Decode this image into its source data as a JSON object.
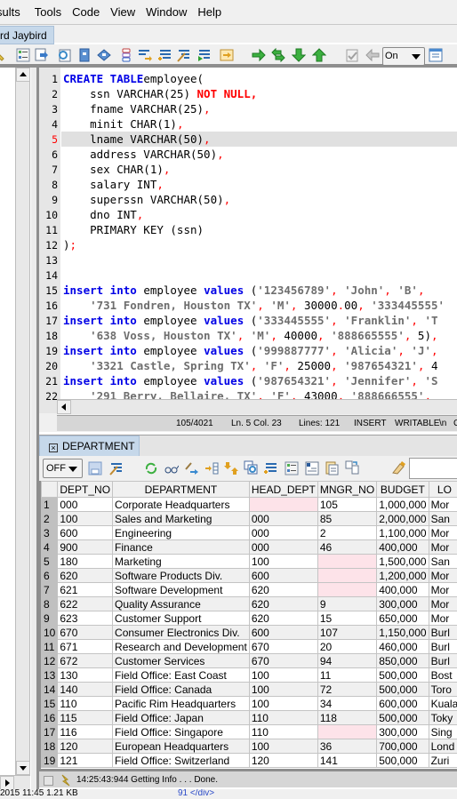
{
  "menubar": {
    "items": [
      "sults",
      "Tools",
      "Code",
      "View",
      "Window",
      "Help"
    ]
  },
  "connection_tab": {
    "label": "rd Jaybird"
  },
  "toolbar": {
    "icons": [
      "plug-icon",
      "form-icon",
      "export-icon",
      "refresh-doc-icon",
      "book-icon",
      "open-book-icon",
      "stack-icon",
      "lines-arrow-icon",
      "lines-plus-icon",
      "lines-pencil-icon",
      "lines-play-icon",
      "table-export-icon",
      "run-arrow-icon",
      "swap-arrows-icon",
      "down-arrow-icon",
      "up-arrow-icon",
      "checklist-icon",
      "back-arrow-icon",
      "panel-icon"
    ],
    "autocommit_select": {
      "value": "On"
    }
  },
  "editor": {
    "lines": [
      {
        "n": "1",
        "tokens": [
          [
            "kw",
            "CREATE TABLE"
          ],
          [
            "",
            "employee("
          ]
        ]
      },
      {
        "n": "2",
        "tokens": [
          [
            "",
            "    ssn VARCHAR(25) "
          ],
          [
            "red",
            "NOT NULL"
          ],
          [
            "red",
            ","
          ]
        ]
      },
      {
        "n": "3",
        "tokens": [
          [
            "",
            "    fname VARCHAR(25)"
          ],
          [
            "pn",
            ","
          ]
        ]
      },
      {
        "n": "4",
        "tokens": [
          [
            "",
            "    minit CHAR(1)"
          ],
          [
            "pn",
            ","
          ]
        ]
      },
      {
        "n": "5",
        "tokens": [
          [
            "",
            "    lname VARCHAR(50)"
          ],
          [
            "pn",
            ","
          ]
        ],
        "current": true
      },
      {
        "n": "6",
        "tokens": [
          [
            "",
            "    address VARCHAR(50)"
          ],
          [
            "pn",
            ","
          ]
        ]
      },
      {
        "n": "7",
        "tokens": [
          [
            "",
            "    sex CHAR(1)"
          ],
          [
            "pn",
            ","
          ]
        ]
      },
      {
        "n": "8",
        "tokens": [
          [
            "",
            "    salary INT"
          ],
          [
            "pn",
            ","
          ]
        ]
      },
      {
        "n": "9",
        "tokens": [
          [
            "",
            "    superssn VARCHAR(50)"
          ],
          [
            "pn",
            ","
          ]
        ]
      },
      {
        "n": "10",
        "tokens": [
          [
            "",
            "    dno INT"
          ],
          [
            "pn",
            ","
          ]
        ]
      },
      {
        "n": "11",
        "tokens": [
          [
            "",
            "    PRIMARY KEY (ssn)"
          ]
        ]
      },
      {
        "n": "12",
        "tokens": [
          [
            "",
            ")"
          ],
          [
            "pn",
            ";"
          ]
        ]
      },
      {
        "n": "13",
        "tokens": []
      },
      {
        "n": "14",
        "tokens": []
      },
      {
        "n": "15",
        "tokens": [
          [
            "kw",
            "insert into"
          ],
          [
            "",
            " employee "
          ],
          [
            "kw",
            "values"
          ],
          [
            "",
            " ("
          ],
          [
            "str",
            "'123456789'"
          ],
          [
            "pn",
            ","
          ],
          [
            "",
            " "
          ],
          [
            "str",
            "'John'"
          ],
          [
            "pn",
            ","
          ],
          [
            "",
            " "
          ],
          [
            "str",
            "'B'"
          ],
          [
            "pn",
            ","
          ]
        ]
      },
      {
        "n": "16",
        "tokens": [
          [
            "",
            "    "
          ],
          [
            "str",
            "'731 Fondren, Houston TX'"
          ],
          [
            "pn",
            ","
          ],
          [
            "",
            " "
          ],
          [
            "str",
            "'M'"
          ],
          [
            "pn",
            ","
          ],
          [
            "",
            " 30000"
          ],
          [
            "pn",
            "."
          ],
          [
            "",
            "00"
          ],
          [
            "pn",
            ","
          ],
          [
            "",
            " "
          ],
          [
            "str",
            "'333445555'"
          ]
        ]
      },
      {
        "n": "17",
        "tokens": [
          [
            "kw",
            "insert into"
          ],
          [
            "",
            " employee "
          ],
          [
            "kw",
            "values"
          ],
          [
            "",
            " ("
          ],
          [
            "str",
            "'333445555'"
          ],
          [
            "pn",
            ","
          ],
          [
            "",
            " "
          ],
          [
            "str",
            "'Franklin'"
          ],
          [
            "pn",
            ","
          ],
          [
            "",
            " "
          ],
          [
            "str",
            "'T"
          ]
        ]
      },
      {
        "n": "18",
        "tokens": [
          [
            "",
            "    "
          ],
          [
            "str",
            "'638 Voss, Houston TX'"
          ],
          [
            "pn",
            ","
          ],
          [
            "",
            " "
          ],
          [
            "str",
            "'M'"
          ],
          [
            "pn",
            ","
          ],
          [
            "",
            " 40000"
          ],
          [
            "pn",
            ","
          ],
          [
            "",
            " "
          ],
          [
            "str",
            "'888665555'"
          ],
          [
            "pn",
            ","
          ],
          [
            "",
            " 5)"
          ],
          [
            "pn",
            ","
          ]
        ]
      },
      {
        "n": "19",
        "tokens": [
          [
            "kw",
            "insert into"
          ],
          [
            "",
            " employee "
          ],
          [
            "kw",
            "values"
          ],
          [
            "",
            " ("
          ],
          [
            "str",
            "'999887777'"
          ],
          [
            "pn",
            ","
          ],
          [
            "",
            " "
          ],
          [
            "str",
            "'Alicia'"
          ],
          [
            "pn",
            ","
          ],
          [
            "",
            " "
          ],
          [
            "str",
            "'J'"
          ],
          [
            "pn",
            ","
          ]
        ]
      },
      {
        "n": "20",
        "tokens": [
          [
            "",
            "    "
          ],
          [
            "str",
            "'3321 Castle, Spring TX'"
          ],
          [
            "pn",
            ","
          ],
          [
            "",
            " "
          ],
          [
            "str",
            "'F'"
          ],
          [
            "pn",
            ","
          ],
          [
            "",
            " 25000"
          ],
          [
            "pn",
            ","
          ],
          [
            "",
            " "
          ],
          [
            "str",
            "'987654321'"
          ],
          [
            "pn",
            ","
          ],
          [
            "",
            " 4"
          ]
        ]
      },
      {
        "n": "21",
        "tokens": [
          [
            "kw",
            "insert into"
          ],
          [
            "",
            " employee "
          ],
          [
            "kw",
            "values"
          ],
          [
            "",
            " ("
          ],
          [
            "str",
            "'987654321'"
          ],
          [
            "pn",
            ","
          ],
          [
            "",
            " "
          ],
          [
            "str",
            "'Jennifer'"
          ],
          [
            "pn",
            ","
          ],
          [
            "",
            " "
          ],
          [
            "str",
            "'S"
          ]
        ]
      },
      {
        "n": "22",
        "tokens": [
          [
            "",
            "    "
          ],
          [
            "str",
            "'291 Berry, Bellaire, TX'"
          ],
          [
            "pn",
            ","
          ],
          [
            "",
            " "
          ],
          [
            "str",
            "'F'"
          ],
          [
            "pn",
            ","
          ],
          [
            "",
            " 43000"
          ],
          [
            "pn",
            ","
          ],
          [
            "",
            " "
          ],
          [
            "str",
            "'888666555'"
          ],
          [
            "pn",
            ","
          ]
        ]
      }
    ],
    "status": {
      "position": "105/4021",
      "line_col": "Ln. 5 Col. 23",
      "lines": "Lines: 121",
      "mode": "INSERT",
      "access": "WRITABLE",
      "eol": "\\n",
      "extra": "C"
    }
  },
  "results": {
    "tab_label": "DEPARTMENT",
    "limit_select": {
      "value": "OFF"
    },
    "toolbar_icons": [
      "save-icon",
      "format-icon",
      "refresh-icon",
      "glasses-icon",
      "edit-arrow-icon",
      "insert-row-icon",
      "move-rows-icon",
      "copy-doc-icon",
      "lines-plus-icon",
      "form-icon",
      "single-record-icon",
      "paste-icon",
      "compare-icon",
      "eraser-icon"
    ],
    "filter_value": "",
    "columns": [
      "DEPT_NO",
      "DEPARTMENT",
      "HEAD_DEPT",
      "MNGR_NO",
      "BUDGET",
      "LO"
    ],
    "rows": [
      {
        "n": "1",
        "cells": [
          "000",
          "Corporate Headquarters",
          null,
          "105",
          "1,000,000",
          "Mor"
        ]
      },
      {
        "n": "2",
        "cells": [
          "100",
          "Sales and Marketing",
          "000",
          "85",
          "2,000,000",
          "San"
        ]
      },
      {
        "n": "3",
        "cells": [
          "600",
          "Engineering",
          "000",
          "2",
          "1,100,000",
          "Mor"
        ]
      },
      {
        "n": "4",
        "cells": [
          "900",
          "Finance",
          "000",
          "46",
          "400,000",
          "Mor"
        ]
      },
      {
        "n": "5",
        "cells": [
          "180",
          "Marketing",
          "100",
          null,
          "1,500,000",
          "San"
        ]
      },
      {
        "n": "6",
        "cells": [
          "620",
          "Software Products Div.",
          "600",
          null,
          "1,200,000",
          "Mor"
        ]
      },
      {
        "n": "7",
        "cells": [
          "621",
          "Software Development",
          "620",
          null,
          "400,000",
          "Mor"
        ]
      },
      {
        "n": "8",
        "cells": [
          "622",
          "Quality Assurance",
          "620",
          "9",
          "300,000",
          "Mor"
        ]
      },
      {
        "n": "9",
        "cells": [
          "623",
          "Customer Support",
          "620",
          "15",
          "650,000",
          "Mor"
        ]
      },
      {
        "n": "10",
        "cells": [
          "670",
          "Consumer Electronics Div.",
          "600",
          "107",
          "1,150,000",
          "Burl"
        ]
      },
      {
        "n": "11",
        "cells": [
          "671",
          "Research and Development",
          "670",
          "20",
          "460,000",
          "Burl"
        ]
      },
      {
        "n": "12",
        "cells": [
          "672",
          "Customer Services",
          "670",
          "94",
          "850,000",
          "Burl"
        ]
      },
      {
        "n": "13",
        "cells": [
          "130",
          "Field Office: East Coast",
          "100",
          "11",
          "500,000",
          "Bost"
        ]
      },
      {
        "n": "14",
        "cells": [
          "140",
          "Field Office: Canada",
          "100",
          "72",
          "500,000",
          "Toro"
        ]
      },
      {
        "n": "15",
        "cells": [
          "110",
          "Pacific Rim Headquarters",
          "100",
          "34",
          "600,000",
          "Kuala"
        ]
      },
      {
        "n": "16",
        "cells": [
          "115",
          "Field Office: Japan",
          "110",
          "118",
          "500,000",
          "Toky"
        ]
      },
      {
        "n": "17",
        "cells": [
          "116",
          "Field Office: Singapore",
          "110",
          null,
          "300,000",
          "Sing"
        ]
      },
      {
        "n": "18",
        "cells": [
          "120",
          "European Headquarters",
          "100",
          "36",
          "700,000",
          "Lond"
        ]
      },
      {
        "n": "19",
        "cells": [
          "121",
          "Field Office: Switzerland",
          "120",
          "141",
          "500,000",
          "Zuri"
        ]
      }
    ],
    "log": "14:25:43:944 Getting Info . . . Done."
  },
  "bottom_strip": {
    "left": "2015 11:45    1.21 KB",
    "right": "91 </div>"
  },
  "colors": {
    "keyword": "#0000e6",
    "punct": "#ff0000",
    "string": "#6e6e6e",
    "null_cell": "#fde3e9",
    "tab_active": "#c6d8ea",
    "current_line": "#e0e0e0"
  }
}
